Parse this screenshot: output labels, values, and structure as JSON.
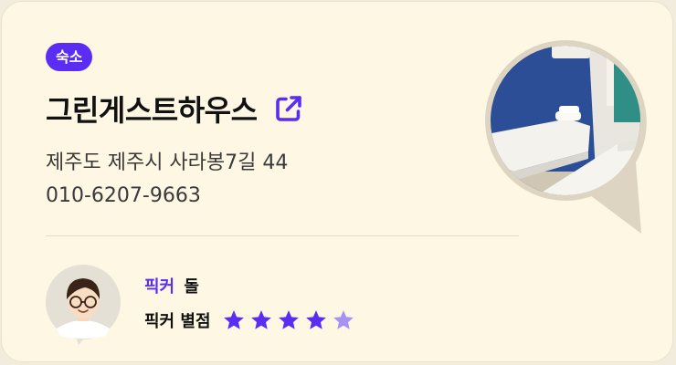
{
  "category_badge": "숙소",
  "place": {
    "name": "그린게스트하우스",
    "address": "제주도 제주시 사라봉7길 44",
    "phone": "010-6207-9663"
  },
  "icons": {
    "external_link": "external-link-icon",
    "photo": "room-photo",
    "avatar": "picker-avatar-icon",
    "star": "star-icon"
  },
  "picker": {
    "label": "픽커",
    "name": "돌",
    "rating_label": "픽커 별점",
    "rating": 4,
    "rating_max": 5
  },
  "colors": {
    "accent": "#5b2cf2",
    "star_filled": "#5b2cf2",
    "star_empty": "#a592f2",
    "card_background": "#fdf7e3"
  }
}
